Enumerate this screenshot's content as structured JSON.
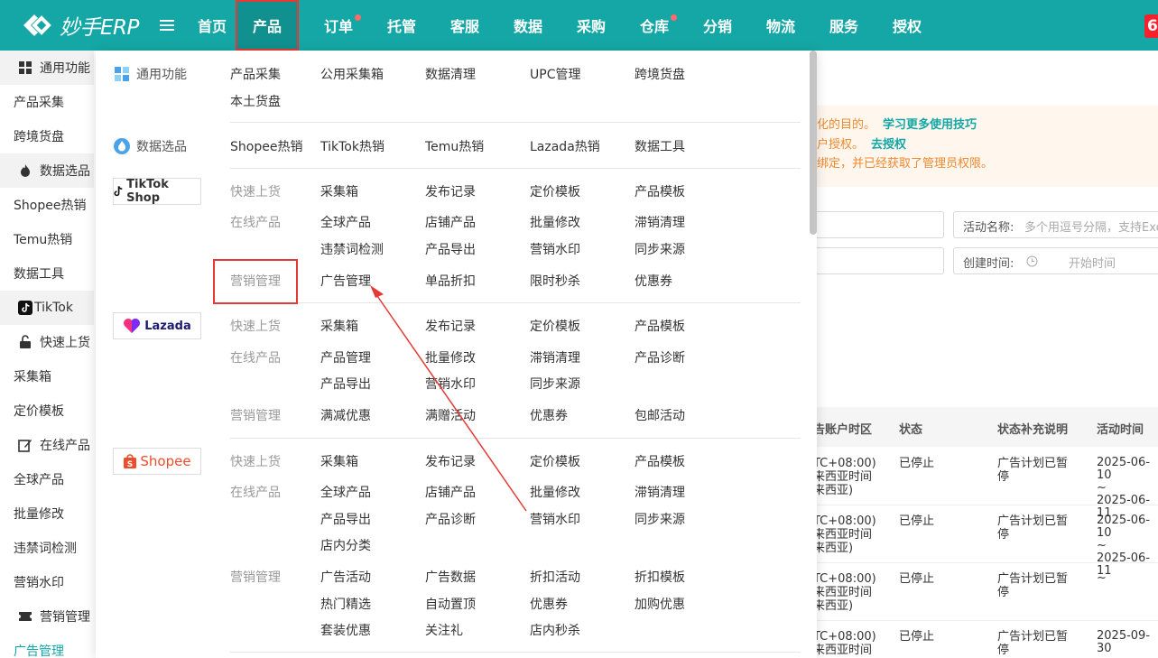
{
  "header": {
    "logo_text": "妙手ERP",
    "nav": [
      {
        "label": "首页",
        "active": false,
        "dot": false
      },
      {
        "label": "产品",
        "active": true,
        "dot": false
      },
      {
        "label": "订单",
        "active": false,
        "dot": true
      },
      {
        "label": "托管",
        "active": false,
        "dot": false
      },
      {
        "label": "客服",
        "active": false,
        "dot": false
      },
      {
        "label": "数据",
        "active": false,
        "dot": false
      },
      {
        "label": "采购",
        "active": false,
        "dot": false
      },
      {
        "label": "仓库",
        "active": false,
        "dot": true
      },
      {
        "label": "分销",
        "active": false,
        "dot": false
      },
      {
        "label": "物流",
        "active": false,
        "dot": false
      },
      {
        "label": "服务",
        "active": false,
        "dot": false
      },
      {
        "label": "授权",
        "active": false,
        "dot": false
      }
    ],
    "right_badge": "6"
  },
  "sidebar": {
    "items": [
      {
        "label": "通用功能",
        "type": "group",
        "icon": "grid-icon"
      },
      {
        "label": "产品采集",
        "type": "plain"
      },
      {
        "label": "跨境货盘",
        "type": "plain"
      },
      {
        "label": "数据选品",
        "type": "group",
        "icon": "fire-icon"
      },
      {
        "label": "Shopee热销",
        "type": "plain"
      },
      {
        "label": "Temu热销",
        "type": "plain"
      },
      {
        "label": "数据工具",
        "type": "plain"
      },
      {
        "label": "TikTok",
        "type": "group",
        "icon": "tiktok-icon"
      },
      {
        "label": "快速上货",
        "type": "group",
        "icon": "lock-icon"
      },
      {
        "label": "采集箱",
        "type": "plain"
      },
      {
        "label": "定价模板",
        "type": "plain"
      },
      {
        "label": "在线产品",
        "type": "group",
        "icon": "edit-icon"
      },
      {
        "label": "全球产品",
        "type": "plain"
      },
      {
        "label": "批量修改",
        "type": "plain"
      },
      {
        "label": "违禁词检测",
        "type": "plain"
      },
      {
        "label": "营销水印",
        "type": "plain"
      },
      {
        "label": "营销管理",
        "type": "group",
        "icon": "ticket-icon"
      },
      {
        "label": "广告管理",
        "type": "active"
      }
    ]
  },
  "tip": {
    "line1": "化的目的。",
    "line1_link": "学习更多使用技巧",
    "line2": "户授权。",
    "line2_link": "去授权",
    "line3": "绑定，并已经获取了管理员权限。"
  },
  "filters": {
    "activity_label": "活动名称:",
    "activity_placeholder": "多个用逗号分隔，支持Exc",
    "created_label": "创建时间:",
    "created_placeholder": "开始时间"
  },
  "table": {
    "headers": [
      "告账户时区",
      "状态",
      "状态补充说明",
      "活动时间"
    ],
    "rows": [
      {
        "tz": [
          "TC+08:00)",
          "来西亚时间",
          "来西亚)"
        ],
        "status": "已停止",
        "note": [
          "广告计划已暂",
          "停"
        ],
        "time": [
          "2025-06-10",
          "~",
          "2025-06-11"
        ]
      },
      {
        "tz": [
          "TC+08:00)",
          "来西亚时间",
          "来西亚)"
        ],
        "status": "已停止",
        "note": [
          "广告计划已暂",
          "停"
        ],
        "time": [
          "2025-06-10",
          "~",
          "2025-06-11"
        ]
      },
      {
        "tz": [
          "TC+08:00)",
          "来西亚时间",
          "来西亚)"
        ],
        "status": "已停止",
        "note": [
          "广告计划已暂",
          "停"
        ],
        "time": [
          "~",
          "",
          ""
        ]
      },
      {
        "tz": [
          "TC+08:00)",
          "来西亚时间",
          ""
        ],
        "status": "已停止",
        "note": [
          "广告计划已暂",
          "停"
        ],
        "time": [
          "2025-09-30",
          "~",
          ""
        ]
      }
    ]
  },
  "dropdown": {
    "general": {
      "title": "通用功能",
      "items": [
        "产品采集",
        "公用采集箱",
        "数据清理",
        "UPC管理",
        "跨境货盘",
        "本土货盘"
      ]
    },
    "data_select": {
      "title": "数据选品",
      "items": [
        "Shopee热销",
        "TikTok热销",
        "Temu热销",
        "Lazada热销",
        "数据工具"
      ]
    },
    "tiktok": {
      "brand": "TikTok Shop",
      "fast_label": "快速上货",
      "fast": [
        "采集箱",
        "发布记录",
        "定价模板",
        "产品模板"
      ],
      "online_label": "在线产品",
      "online": [
        "全球产品",
        "店铺产品",
        "批量修改",
        "滞销清理",
        "违禁词检测",
        "产品导出",
        "营销水印",
        "同步来源"
      ],
      "marketing_label": "营销管理",
      "marketing": [
        "广告管理",
        "单品折扣",
        "限时秒杀",
        "优惠券"
      ]
    },
    "lazada": {
      "brand": "Lazada",
      "fast_label": "快速上货",
      "fast": [
        "采集箱",
        "发布记录",
        "定价模板",
        "产品模板"
      ],
      "online_label": "在线产品",
      "online": [
        "产品管理",
        "批量修改",
        "滞销清理",
        "产品诊断",
        "产品导出",
        "营销水印",
        "同步来源"
      ],
      "marketing_label": "营销管理",
      "marketing": [
        "满减优惠",
        "满赠活动",
        "优惠券",
        "包邮活动"
      ]
    },
    "shopee": {
      "brand": "Shopee",
      "fast_label": "快速上货",
      "fast": [
        "采集箱",
        "发布记录",
        "定价模板",
        "产品模板"
      ],
      "online_label": "在线产品",
      "online": [
        "全球产品",
        "店铺产品",
        "批量修改",
        "滞销清理",
        "产品导出",
        "产品诊断",
        "营销水印",
        "同步来源",
        "店内分类"
      ],
      "marketing_label": "营销管理",
      "marketing": [
        "广告活动",
        "广告数据",
        "折扣活动",
        "折扣模板",
        "热门精选",
        "自动置顶",
        "优惠券",
        "加购优惠",
        "套装优惠",
        "关注礼",
        "店内秒杀"
      ]
    }
  },
  "colors": {
    "brand": "#14a7a5",
    "highlight": "#e53935",
    "warning": "#ef8a2f"
  }
}
